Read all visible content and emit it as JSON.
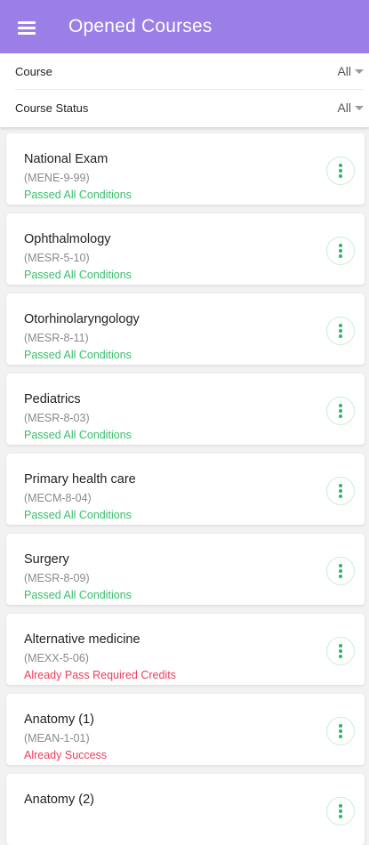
{
  "header": {
    "title": "Opened Courses"
  },
  "filters": {
    "course": {
      "label": "Course",
      "value": "All"
    },
    "status": {
      "label": "Course Status",
      "value": "All"
    }
  },
  "colors": {
    "appbar": "#9c7fe6",
    "status_green": "#35c06a",
    "status_red": "#ee3d5c"
  },
  "courses": [
    {
      "name": "National Exam",
      "code": "(MENE-9-99)",
      "status": "Passed All Conditions",
      "status_color": "green"
    },
    {
      "name": "Ophthalmology",
      "code": "(MESR-5-10)",
      "status": "Passed All Conditions",
      "status_color": "green"
    },
    {
      "name": "Otorhinolaryngology",
      "code": "(MESR-8-11)",
      "status": "Passed All Conditions",
      "status_color": "green"
    },
    {
      "name": "Pediatrics",
      "code": "(MESR-8-03)",
      "status": "Passed All Conditions",
      "status_color": "green"
    },
    {
      "name": "Primary health care",
      "code": "(MECM-8-04)",
      "status": "Passed All Conditions",
      "status_color": "green"
    },
    {
      "name": "Surgery",
      "code": "(MESR-8-09)",
      "status": "Passed All Conditions",
      "status_color": "green"
    },
    {
      "name": "Alternative medicine",
      "code": "(MEXX-5-06)",
      "status": "Already Pass Required Credits",
      "status_color": "red"
    },
    {
      "name": "Anatomy (1)",
      "code": "(MEAN-1-01)",
      "status": "Already Success",
      "status_color": "red"
    },
    {
      "name": "Anatomy (2)",
      "code": "",
      "status": "",
      "status_color": "red"
    }
  ]
}
